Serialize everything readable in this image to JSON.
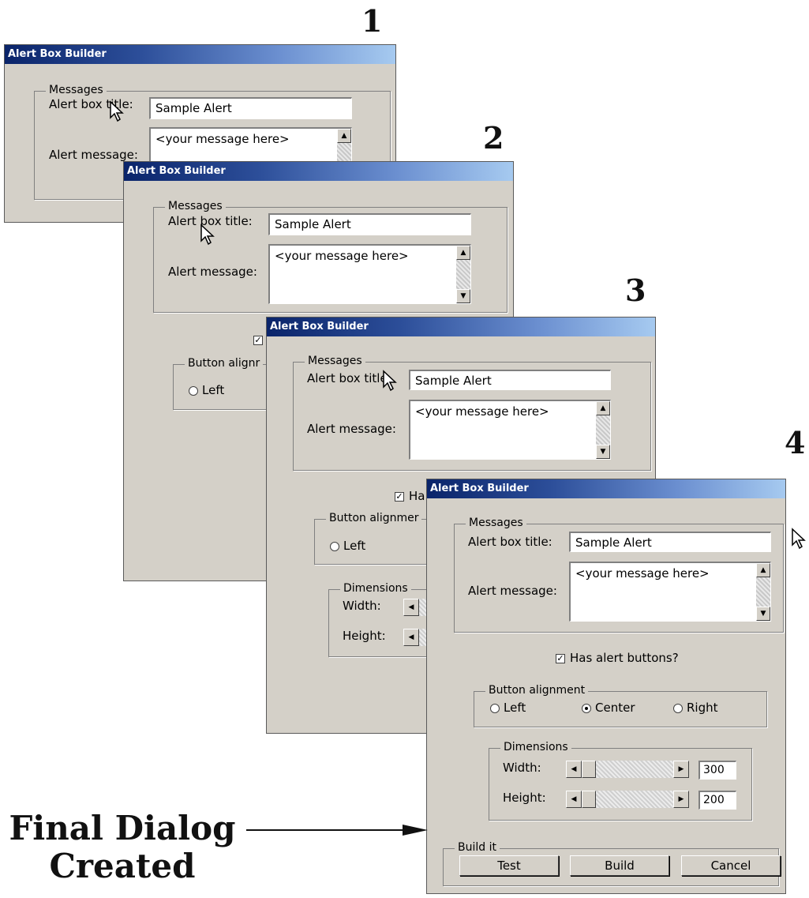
{
  "step_numbers": [
    "1",
    "2",
    "3",
    "4"
  ],
  "dialog": {
    "title": "Alert Box Builder",
    "messages_legend": "Messages",
    "alert_title_label": "Alert box title:",
    "alert_title_value": "Sample Alert",
    "alert_message_label": "Alert message:",
    "alert_message_value": "<your message here>",
    "has_buttons_label": "Has alert buttons?",
    "has_buttons_checked": true,
    "alignment_legend": "Button alignment",
    "alignment_options": [
      "Left",
      "Center",
      "Right"
    ],
    "alignment_selected": "Center",
    "dimensions_legend": "Dimensions",
    "width_label": "Width:",
    "width_value": "300",
    "height_label": "Height:",
    "height_value": "200",
    "build_legend": "Build it",
    "buttons": {
      "test": "Test",
      "build": "Build",
      "cancel": "Cancel"
    }
  },
  "partial": {
    "title_label_short": "Alert box title",
    "alignment_legend_partial": "Button alignmer",
    "alignment_legend_partial_2": "Button alignr",
    "has_buttons_partial": "Ha"
  },
  "caption": {
    "line1": "Final Dialog",
    "line2": "Created"
  },
  "colors": {
    "titlebar_start": "#0a246a",
    "titlebar_end": "#a6caf0",
    "dialog_bg": "#d4d0c8"
  }
}
